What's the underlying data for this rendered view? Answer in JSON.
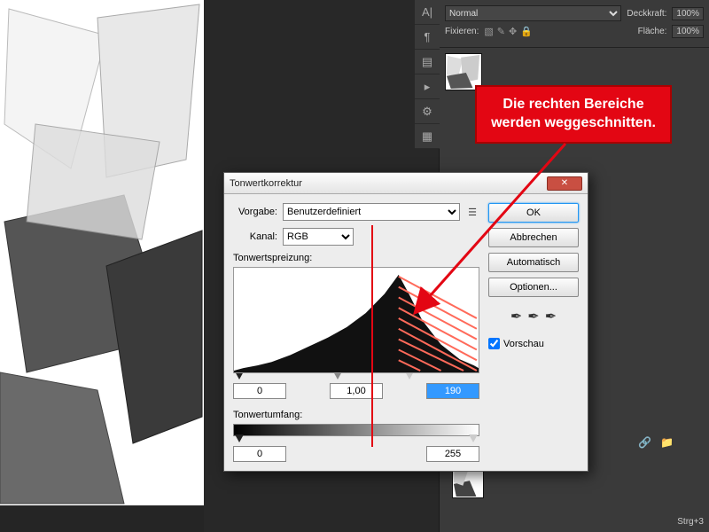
{
  "canvas": {
    "desc": "crystal-photo"
  },
  "layersPanel": {
    "blendMode": "Normal",
    "opacityLabel": "Deckkraft:",
    "opacityValue": "100%",
    "lockLabel": "Fixieren:",
    "fillLabel": "Fläche:",
    "fillValue": "100%",
    "shortcut": "Strg+3"
  },
  "dialog": {
    "title": "Tonwertkorrektur",
    "presetLabel": "Vorgabe:",
    "presetValue": "Benutzerdefiniert",
    "channelLabel": "Kanal:",
    "channelValue": "RGB",
    "inputLabel": "Tonwertspreizung:",
    "outputLabel": "Tonwertumfang:",
    "shadows": "0",
    "mid": "1,00",
    "highlights": "190",
    "outLow": "0",
    "outHigh": "255",
    "buttons": {
      "ok": "OK",
      "cancel": "Abbrechen",
      "auto": "Automatisch",
      "options": "Optionen..."
    },
    "previewLabel": "Vorschau"
  },
  "annotation": {
    "line1": "Die rechten Bereiche",
    "line2": "werden weggeschnitten."
  },
  "chart_data": {
    "type": "area",
    "title": "Tonwertspreizung",
    "xlabel": "",
    "ylabel": "",
    "x_range": [
      0,
      255
    ],
    "input_black": 0,
    "input_gamma": 1.0,
    "input_white": 190,
    "output_black": 0,
    "output_white": 255,
    "histogram_approx": [
      {
        "x": 0,
        "y": 3
      },
      {
        "x": 20,
        "y": 6
      },
      {
        "x": 40,
        "y": 10
      },
      {
        "x": 60,
        "y": 18
      },
      {
        "x": 80,
        "y": 26
      },
      {
        "x": 100,
        "y": 34
      },
      {
        "x": 120,
        "y": 42
      },
      {
        "x": 140,
        "y": 55
      },
      {
        "x": 160,
        "y": 75
      },
      {
        "x": 175,
        "y": 95
      },
      {
        "x": 185,
        "y": 68
      },
      {
        "x": 200,
        "y": 35
      },
      {
        "x": 220,
        "y": 18
      },
      {
        "x": 240,
        "y": 8
      },
      {
        "x": 255,
        "y": 4
      }
    ]
  }
}
